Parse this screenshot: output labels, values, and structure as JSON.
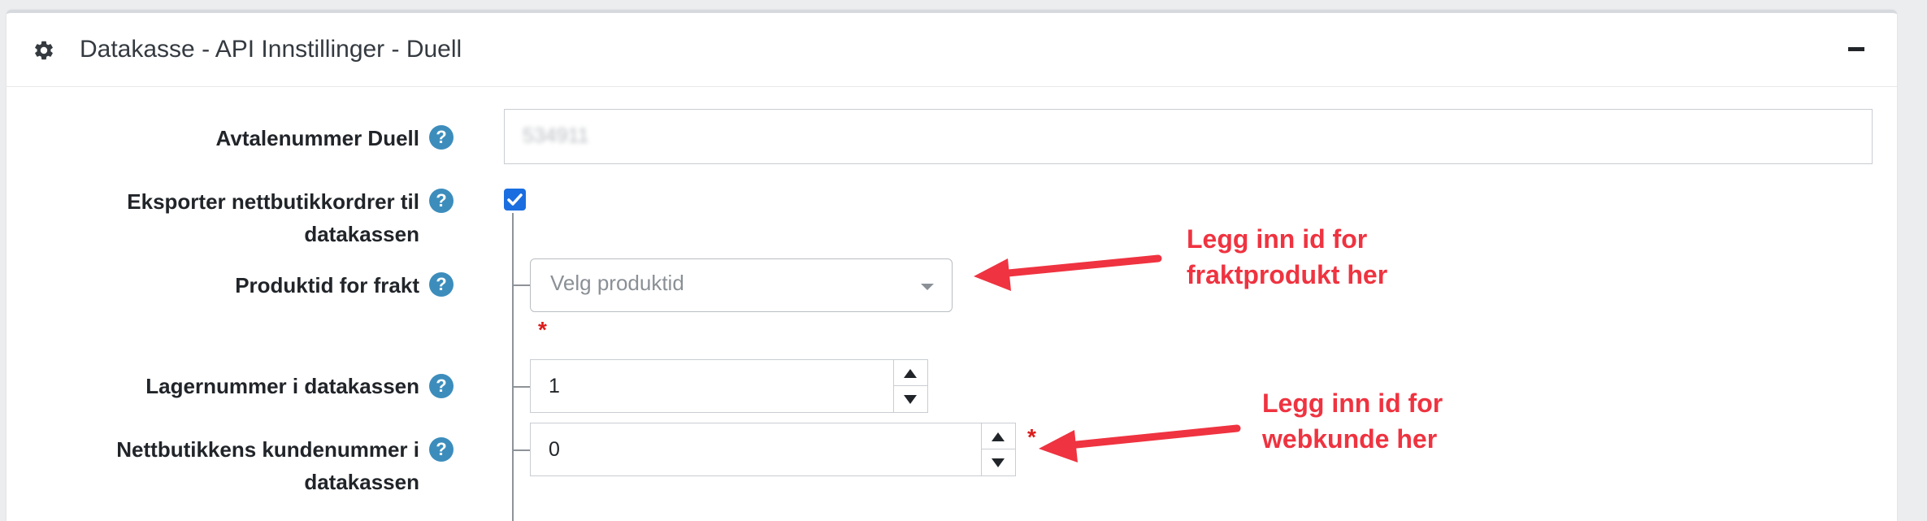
{
  "card": {
    "title": "Datakasse - API Innstillinger - Duell",
    "icon": "gear-icon",
    "collapse_icon": "minus-icon"
  },
  "fields": {
    "avtalenummer": {
      "label": "Avtalenummer Duell",
      "value": "534911",
      "value_blurred": true
    },
    "eksporter": {
      "label_line1": "Eksporter nettbutikkordrer til",
      "label_line2": "datakassen",
      "checked": true
    },
    "produktid": {
      "label": "Produktid for frakt",
      "placeholder": "Velg produktid",
      "required_mark": "*"
    },
    "lagernummer": {
      "label": "Lagernummer i datakassen",
      "value": "1"
    },
    "kundenummer": {
      "label_line1": "Nettbutikkens kundenummer i",
      "label_line2": "datakassen",
      "value": "0",
      "required_mark": "*"
    }
  },
  "help_glyph": "?",
  "annotations": {
    "frakt_line1": "Legg inn id for",
    "frakt_line2": "fraktprodukt her",
    "webkunde_line1": "Legg inn id for",
    "webkunde_line2": "webkunde her"
  },
  "colors": {
    "accent": "#1a6ee0",
    "help": "#3c8dbc",
    "annotation": "#ef3340",
    "required": "#dc1c1c"
  }
}
